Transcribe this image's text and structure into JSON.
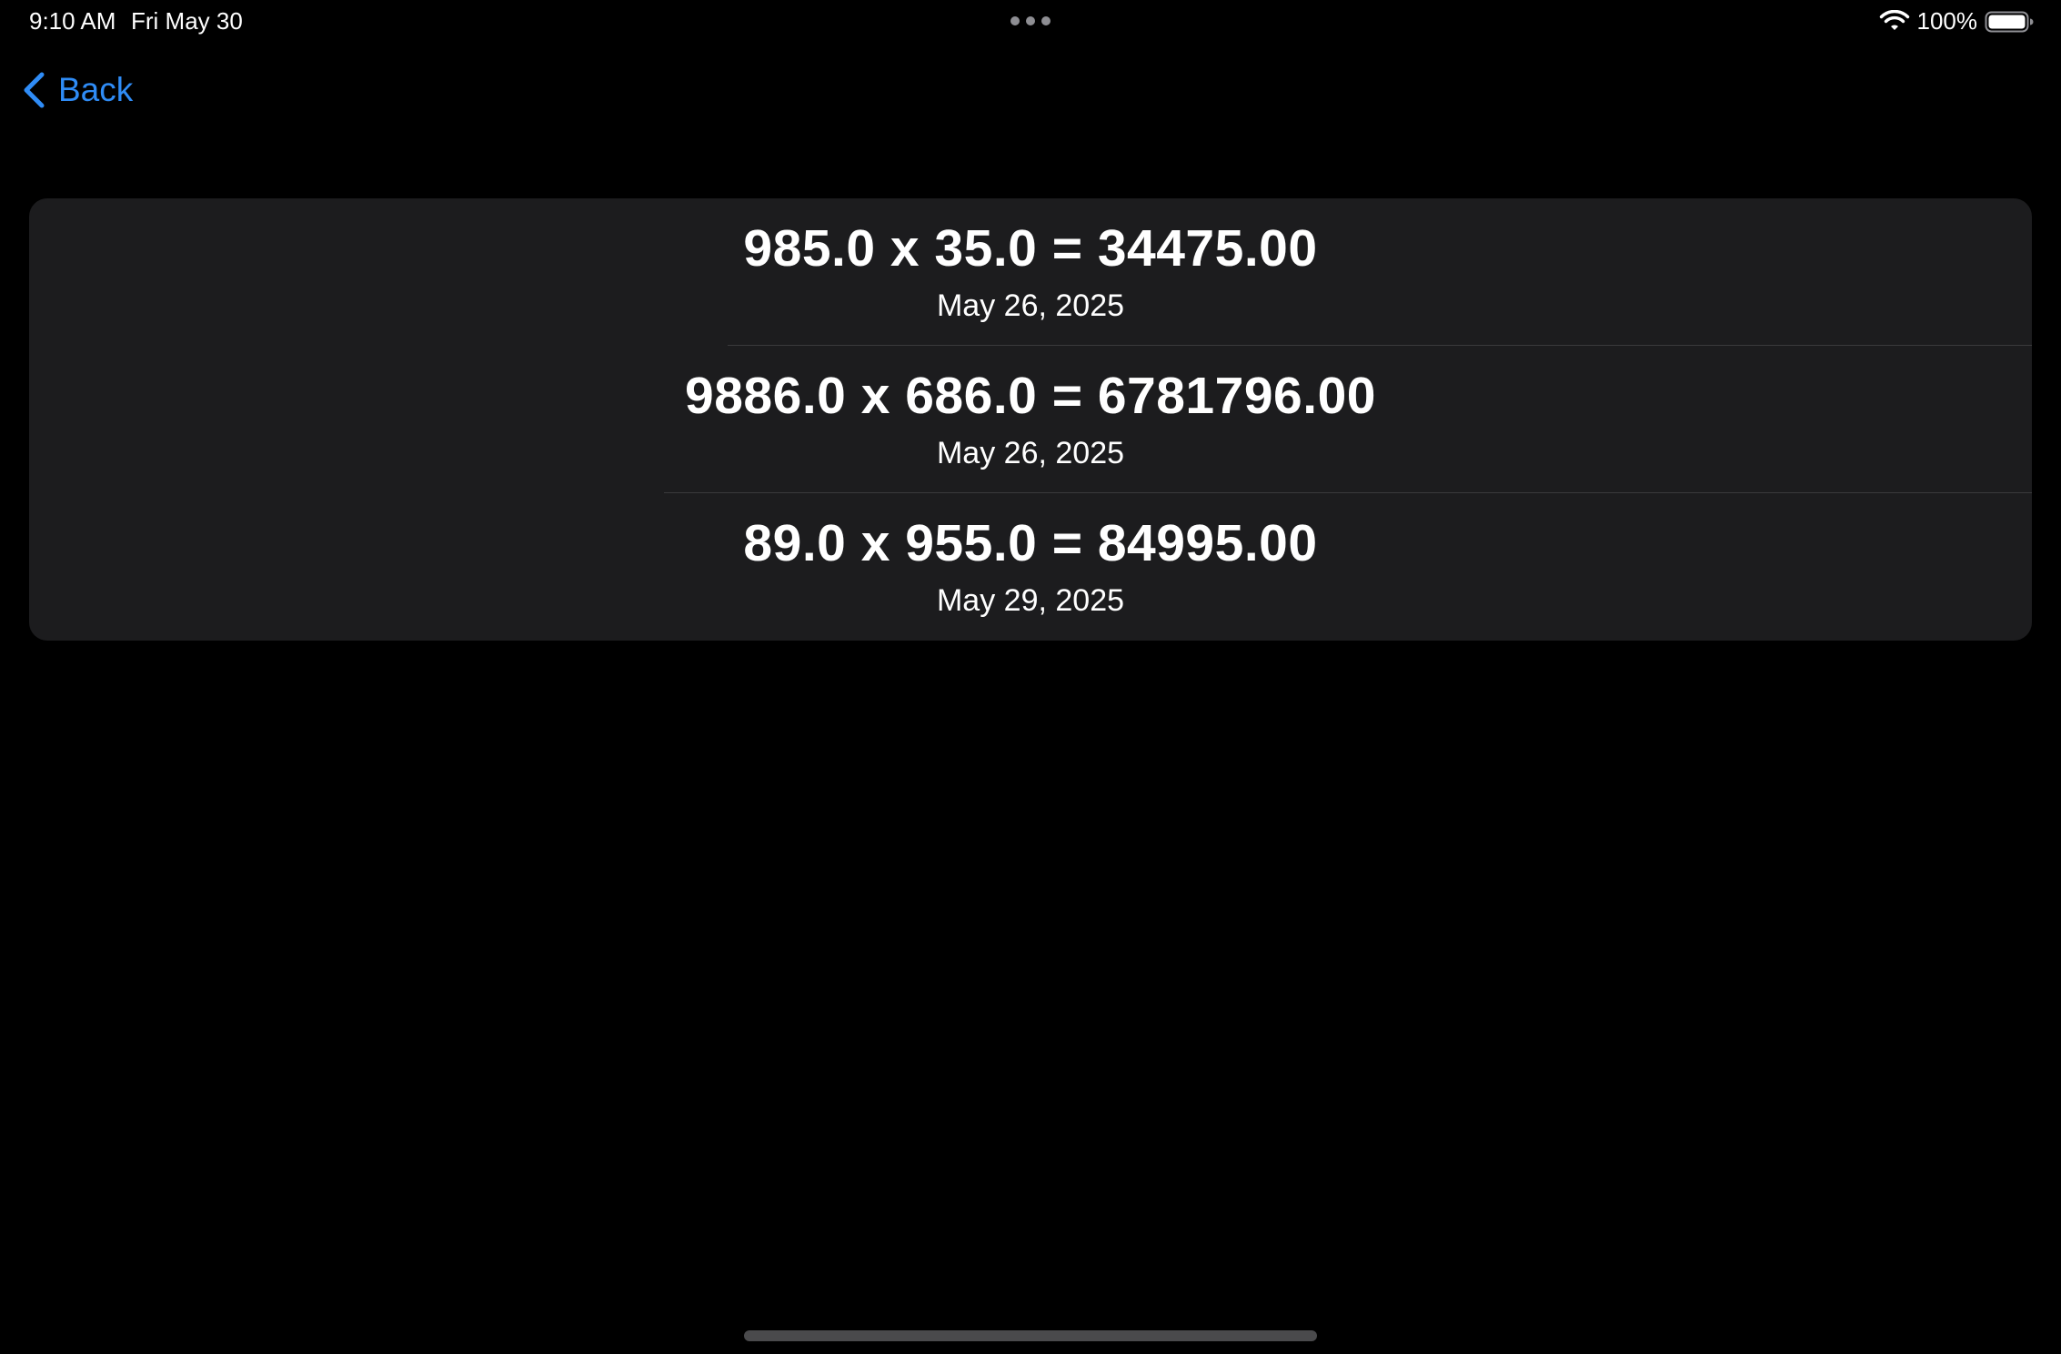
{
  "status_bar": {
    "time": "9:10 AM",
    "date": "Fri May 30",
    "battery": "100%",
    "icons": [
      "multitask-dots-icon",
      "wifi-icon",
      "battery-icon"
    ]
  },
  "nav": {
    "back_label": "Back",
    "back_icon": "chevron-left-icon",
    "accent_color": "#2f8cf6"
  },
  "history": {
    "items": [
      {
        "equation": "985.0 x 35.0 = 34475.00",
        "date": "May 26, 2025"
      },
      {
        "equation": "9886.0 x 686.0 = 6781796.00",
        "date": "May 26, 2025"
      },
      {
        "equation": "89.0 x 955.0 = 84995.00",
        "date": "May 29, 2025"
      }
    ]
  },
  "colors": {
    "background": "#000000",
    "card": "#1c1c1e",
    "separator": "#3a3a3c",
    "text": "#ffffff"
  }
}
